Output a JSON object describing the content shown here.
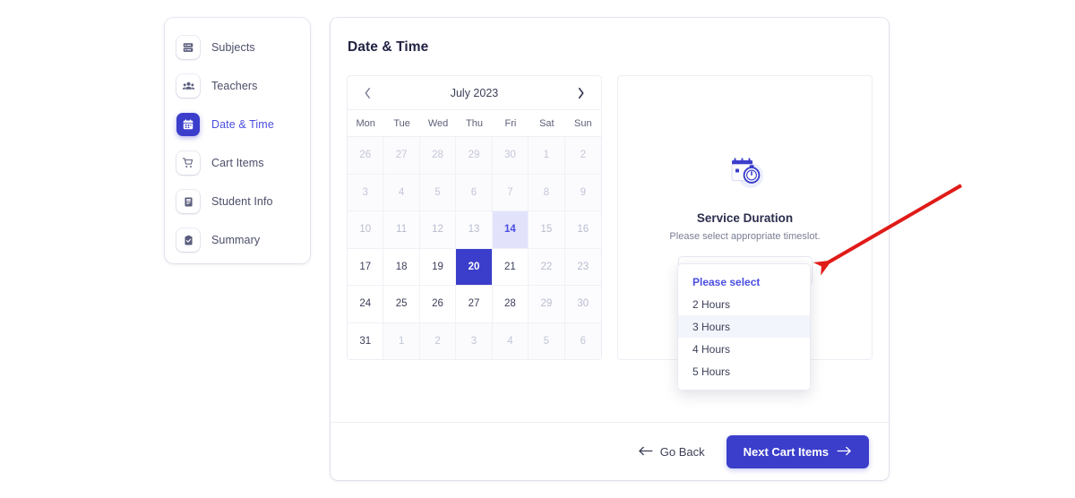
{
  "sidebar": {
    "items": [
      {
        "label": "Subjects",
        "icon": "server-icon",
        "active": false
      },
      {
        "label": "Teachers",
        "icon": "users-icon",
        "active": false
      },
      {
        "label": "Date & Time",
        "icon": "calendar-icon",
        "active": true
      },
      {
        "label": "Cart Items",
        "icon": "shopping-cart-icon",
        "active": false
      },
      {
        "label": "Student Info",
        "icon": "document-icon",
        "active": false
      },
      {
        "label": "Summary",
        "icon": "clipboard-check-icon",
        "active": false
      }
    ]
  },
  "main": {
    "title": "Date & Time",
    "footer": {
      "back_label": "Go Back",
      "back_icon": "arrow-left-icon",
      "next_label": "Next Cart Items",
      "next_icon": "arrow-right-icon"
    }
  },
  "calendar": {
    "month_label": "July 2023",
    "prev_icon": "chevron-left-icon",
    "next_icon": "chevron-right-icon",
    "weekdays": [
      "Mon",
      "Tue",
      "Wed",
      "Thu",
      "Fri",
      "Sat",
      "Sun"
    ],
    "days": [
      {
        "n": 26,
        "state": "muted"
      },
      {
        "n": 27,
        "state": "muted"
      },
      {
        "n": 28,
        "state": "muted"
      },
      {
        "n": 29,
        "state": "muted"
      },
      {
        "n": 30,
        "state": "muted"
      },
      {
        "n": 1,
        "state": "muted"
      },
      {
        "n": 2,
        "state": "muted"
      },
      {
        "n": 3,
        "state": "muted"
      },
      {
        "n": 4,
        "state": "muted"
      },
      {
        "n": 5,
        "state": "muted"
      },
      {
        "n": 6,
        "state": "muted"
      },
      {
        "n": 7,
        "state": "muted"
      },
      {
        "n": 8,
        "state": "muted"
      },
      {
        "n": 9,
        "state": "muted"
      },
      {
        "n": 10,
        "state": "dim"
      },
      {
        "n": 11,
        "state": "dim"
      },
      {
        "n": 12,
        "state": "dim"
      },
      {
        "n": 13,
        "state": "dim"
      },
      {
        "n": 14,
        "state": "today"
      },
      {
        "n": 15,
        "state": "dim"
      },
      {
        "n": 16,
        "state": "dim"
      },
      {
        "n": 17,
        "state": "avail"
      },
      {
        "n": 18,
        "state": "avail"
      },
      {
        "n": 19,
        "state": "avail"
      },
      {
        "n": 20,
        "state": "selected"
      },
      {
        "n": 21,
        "state": "avail"
      },
      {
        "n": 22,
        "state": "dim"
      },
      {
        "n": 23,
        "state": "dim"
      },
      {
        "n": 24,
        "state": "avail"
      },
      {
        "n": 25,
        "state": "avail"
      },
      {
        "n": 26,
        "state": "avail"
      },
      {
        "n": 27,
        "state": "avail"
      },
      {
        "n": 28,
        "state": "avail"
      },
      {
        "n": 29,
        "state": "dim"
      },
      {
        "n": 30,
        "state": "dim"
      },
      {
        "n": 31,
        "state": "avail"
      },
      {
        "n": 1,
        "state": "muted"
      },
      {
        "n": 2,
        "state": "muted"
      },
      {
        "n": 3,
        "state": "muted"
      },
      {
        "n": 4,
        "state": "muted"
      },
      {
        "n": 5,
        "state": "muted"
      },
      {
        "n": 6,
        "state": "muted"
      }
    ]
  },
  "duration": {
    "icon": "calendar-timer-icon",
    "title": "Service Duration",
    "subtitle": "Please select appropriate timeslot.",
    "select": {
      "value": "Please select",
      "chevron_icon": "chevron-up-icon",
      "open": true,
      "options": [
        {
          "label": "Please select",
          "state": "selected"
        },
        {
          "label": "2 Hours",
          "state": "normal"
        },
        {
          "label": "3 Hours",
          "state": "hover"
        },
        {
          "label": "4 Hours",
          "state": "normal"
        },
        {
          "label": "5 Hours",
          "state": "normal"
        }
      ]
    }
  },
  "annotation": {
    "icon": "red-arrow-annotation",
    "color": "#e01b18"
  },
  "colors": {
    "accent": "#3b3ecb",
    "accent_text": "#4a4de0",
    "today_bg": "#e2e3fb",
    "heading": "#232346",
    "body_text": "#3d4059",
    "muted_text": "#c3c6d6",
    "border": "#eceef4"
  }
}
